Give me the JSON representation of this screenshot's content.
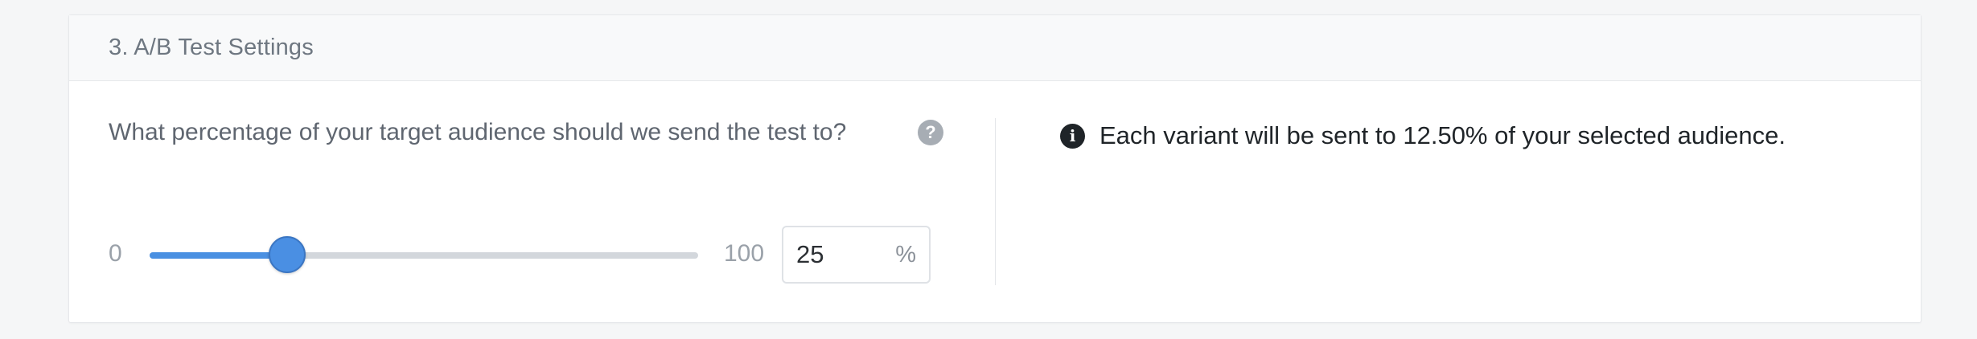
{
  "section": {
    "title": "3. A/B Test Settings"
  },
  "question": {
    "text": "What percentage of your target audience should we send the test to?",
    "help_icon": "question-circle-icon",
    "help_glyph": "?"
  },
  "slider": {
    "min_label": "0",
    "max_label": "100",
    "value": 25,
    "min": 0,
    "max": 100,
    "accent_color": "#4a90e2"
  },
  "percent_input": {
    "value": "25",
    "suffix": "%"
  },
  "info": {
    "icon": "info-circle-icon",
    "glyph": "i",
    "message": "Each variant will be sent to 12.50% of your selected audience."
  }
}
